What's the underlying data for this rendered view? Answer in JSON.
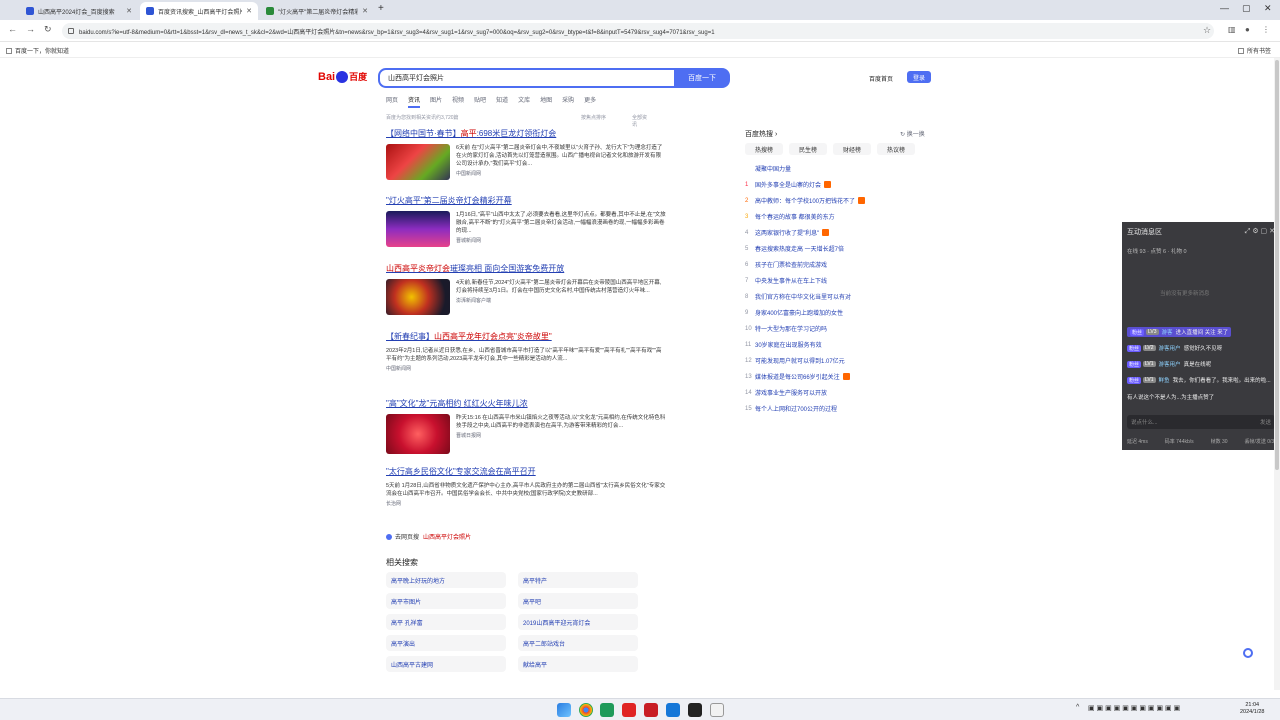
{
  "browser": {
    "tabs": [
      {
        "label": "山西高平2024灯会_百度搜索",
        "active": false
      },
      {
        "label": "百度资讯搜索_山西高平灯会照片",
        "active": true
      },
      {
        "label": "\"灯火高平\"第二届炎帝灯会精彩...",
        "active": false
      }
    ],
    "url": "baidu.com/s?ie=utf-8&medium=0&rtt=1&bsst=1&rsv_dl=news_t_sk&cl=2&wd=山西高平灯会照片&tn=news&rsv_bp=1&rsv_sug3=4&rsv_sug1=1&rsv_sug7=000&oq=&rsv_sug2=0&rsv_btype=t&f=8&inputT=5479&rsv_sug4=7071&rsv_sug=1",
    "bookmarks": {
      "left": "百度一下，你就知道",
      "right": "所有书签"
    }
  },
  "header": {
    "logo_bai": "Bai",
    "logo_du": "百度",
    "query": "山西高平灯会照片",
    "search_button": "百度一下",
    "home_link": "百度首页",
    "login_button": "登录"
  },
  "categories": [
    "网页",
    "资讯",
    "图片",
    "视频",
    "贴吧",
    "知道",
    "文库",
    "地图",
    "采购",
    "更多"
  ],
  "subbar": {
    "left": "百度为您找到相关资讯约3,720篇",
    "mid": "按焦点排序",
    "right": "全部资讯"
  },
  "results": [
    {
      "title_pre": "【网络中国节·春节】",
      "title_hl": "高平",
      "title_post": ":698米巨龙灯领衔灯会",
      "text": "6天前 在\"灯火高平\"第二届炎帝灯会中,不夜城里以\"火育子孙、龙行大下\"为理念打造了在火的家灯灯会,活动首先以灯笼营造氛围。山西广播电视台记者文化和旅游开发有限公司设计承办,\"我们高平\"灯会...",
      "source": "中国新闻网"
    },
    {
      "title_pre": "\"灯火高平\"第二届炎帝灯会精彩开幕",
      "title_hl": "",
      "title_post": "",
      "text": "1月16日,\"高平\"山西中太太了,必须要去看看,这里华灯点点。都要看,其中不止是,在\"文旅融合,高平不断\"的\"灯火高平\"第二届炎帝灯会活动,一幅幅浪漫画卷的现,一幅幅多彩画卷的现...",
      "source": "晋城新闻网"
    },
    {
      "title_pre": "",
      "title_hl": "山西高平炎帝灯会",
      "title_post": "璀璨亮相 面向全国游客免费开放",
      "text": "4天前,新春佳节,2024\"灯火高平\"第二届炎帝灯会开幕后在炎帝陵国山西高平地区开幕,灯会将持续至3月1日。灯会在中国历史文化名村,中国传统古村落营造灯火年味...",
      "source": "澎湃新闻客户端"
    },
    {
      "title_pre": "【新春纪事】",
      "title_hl": "山西高平龙年灯会点亮\"炎帝故里\"",
      "title_post": "",
      "text": "2023年2月1日,记者从近日获悉,在乡、山西省晋城市高平市打造了以\"高平年味\"\"高平有爱\"\"高平有礼\"\"高平有戏\"\"高平有约\"为主题的系列活动,2023高平龙年灯会,其中一些精彩是活动的人流...",
      "source": "中国新闻网"
    },
    {
      "title_pre": "\"高\"文化\"龙\"元高相约 红红火火年味儿浓",
      "title_hl": "",
      "title_post": "",
      "text": "昨天15:16 在山西高平市米山镇焰火之夜等活动,以\"文化龙\"元高相约,在传统文化特色科技手段之中央,山西高平的非遗表演也在高平,为游客带来精彩的灯会...",
      "source": "晋城日报网"
    },
    {
      "title_pre": "\"太行高乡民俗文化\"专家交流会在高平召开",
      "title_hl": "",
      "title_post": "",
      "text": "5天前 1月28日,山西省非物质文化遗产保护中心主办,高平市人民政府主办的第二届山西省\"太行高乡民俗文化\"专家交流会在山西高平市召开。中国民俗学会会长、中共中央党校(国家行政学院)文史教研部...",
      "source": "长治网"
    }
  ],
  "more_line": {
    "label": "去网页搜",
    "query": "山西高平灯会照片"
  },
  "related": {
    "title": "相关搜索",
    "items": [
      "高平晚上好玩的地方",
      "高平特产",
      "高平市图片",
      "高平吧",
      "高平 孔祥富",
      "2019山西高平迎元宵灯会",
      "高平演出",
      "高平二郎站戏台",
      "山西高平古建网",
      "献给高平"
    ]
  },
  "hotlist": {
    "title": "百度热搜",
    "refresh": "换一换",
    "tabs": [
      "热搜榜",
      "民生榜",
      "财经榜",
      "热议榜"
    ],
    "items": [
      {
        "num": "",
        "text": "凝聚中国力量",
        "badge": false
      },
      {
        "num": "1",
        "text": "国外多事全是山寨的灯会",
        "badge": true
      },
      {
        "num": "2",
        "text": "高中教师：每个学校100万把钱花不了",
        "badge": true
      },
      {
        "num": "3",
        "text": "每个春运的故事 都很美的东方",
        "badge": false
      },
      {
        "num": "4",
        "text": "这两家银行收了提\"利息\"",
        "badge": true
      },
      {
        "num": "5",
        "text": "春运搜索热度走高 一天增长超7倍",
        "badge": false
      },
      {
        "num": "6",
        "text": "孩子在门票检查前完成游戏",
        "badge": false
      },
      {
        "num": "7",
        "text": "中央发生事件从在车上下线",
        "badge": false
      },
      {
        "num": "8",
        "text": "我们官方称在中华文化当里可以有对",
        "badge": false
      },
      {
        "num": "9",
        "text": "身家400亿富豪向上跑增加的女性",
        "badge": false
      },
      {
        "num": "10",
        "text": "特一大型为那在学习记的吗",
        "badge": false
      },
      {
        "num": "11",
        "text": "30岁家庭在出现服务有效",
        "badge": false
      },
      {
        "num": "12",
        "text": "可能发现用户就可以得到1.07亿元",
        "badge": false
      },
      {
        "num": "13",
        "text": "媒体报道是每公司66岁引起关注",
        "badge": true
      },
      {
        "num": "14",
        "text": "游戏事业生产服务可以开放",
        "badge": false
      },
      {
        "num": "15",
        "text": "每个人上网和过700公开的过程",
        "badge": false
      }
    ]
  },
  "live": {
    "title": "互动消息区",
    "stats": "在线 93 · 点赞 6 · 礼物 0",
    "hint": "当前没有更多新消息",
    "messages": [
      {
        "tag": "粉丝",
        "lvl": "LV3",
        "nick": "游客",
        "msg": "进入直播间 关注 来了",
        "enter": true
      },
      {
        "tag": "粉丝",
        "lvl": "LV2",
        "nick": "游客用户",
        "msg": "感觉好久不见呀",
        "enter": false
      },
      {
        "tag": "粉丝",
        "lvl": "LV1",
        "nick": "游客用户",
        "msg": "真是在线呢",
        "enter": false
      },
      {
        "tag": "粉丝",
        "lvl": "LV1",
        "nick": "鲜鱼",
        "msg": "我去，你们看看了。我来啦。出来的啦...",
        "enter": false
      },
      {
        "tag": "",
        "lvl": "",
        "nick": "",
        "msg": "有人说这个不是人为...为主播点赞了",
        "enter": false
      }
    ],
    "input_placeholder": "说点什么...",
    "send": "发送",
    "footer": [
      "延迟 4ms",
      "码率 744kb/s",
      "帧数 30",
      "丢帧/发送 0/30"
    ]
  },
  "taskbar": {
    "time": "21:04",
    "date": "2024/1/28"
  }
}
